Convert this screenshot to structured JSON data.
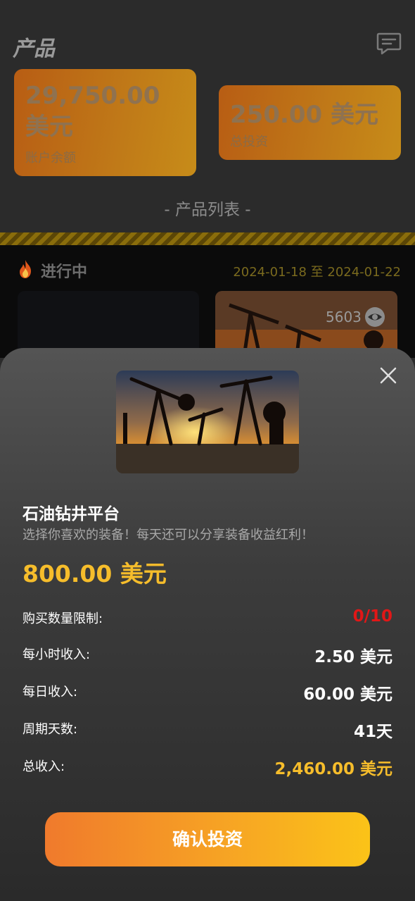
{
  "header": {
    "title": "产品"
  },
  "stats": {
    "balance_value": "29,750.00 美元",
    "balance_label": "账户余额",
    "invest_value": "250.00 美元",
    "invest_label": "总投资"
  },
  "list": {
    "title": "- 产品列表 -",
    "status_label": "进行中",
    "date_range": "2024-01-18 至 2024-01-22",
    "view_count": "5603"
  },
  "sheet": {
    "product_name": "石油钻井平台",
    "product_desc": "选择你喜欢的装备！每天还可以分享装备收益红利！",
    "price": "800.00 美元",
    "rows": [
      {
        "label": "购买数量限制:",
        "value": "0/10"
      },
      {
        "label": "每小时收入:",
        "value": "2.50 美元"
      },
      {
        "label": "每日收入:",
        "value": "60.00 美元"
      },
      {
        "label": "周期天数:",
        "value": "41天"
      },
      {
        "label": "总收入:",
        "value": "2,460.00 美元"
      }
    ],
    "confirm_label": "确认投资"
  },
  "colors": {
    "accent_gold": "#f6bd2b",
    "limit_red": "#e11717",
    "card_orange": "#c07a18"
  },
  "icons": [
    "chat-icon",
    "fire-icon",
    "eye-icon",
    "close-icon"
  ]
}
